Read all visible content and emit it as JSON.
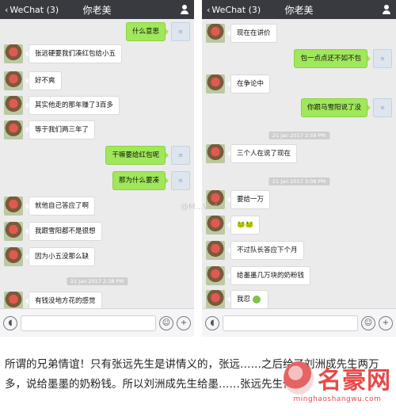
{
  "left_phone": {
    "back_label": "WeChat (3)",
    "title": "你老美",
    "messages": [
      {
        "side": "right",
        "text": "什么意思"
      },
      {
        "side": "left",
        "text": "张远硬要我们凑红包给小五"
      },
      {
        "side": "left",
        "text": "好不爽"
      },
      {
        "side": "left",
        "text": "其实他走的那年赚了3百多"
      },
      {
        "side": "left",
        "text": "等于我们两三年了"
      },
      {
        "side": "right",
        "text": "干嘛要给红包呢"
      },
      {
        "side": "right",
        "text": "那为什么要凑"
      },
      {
        "side": "left",
        "text": "就他自己答应了啊"
      },
      {
        "side": "left",
        "text": "我跟雪阳都不是很想"
      },
      {
        "side": "left",
        "text": "因为小五没那么缺"
      },
      {
        "side": "stamp",
        "text": "21 Jan 2017 2:38 PM"
      },
      {
        "side": "left",
        "text": "有钱没地方花的感觉"
      }
    ]
  },
  "right_phone": {
    "back_label": "WeChat (3)",
    "title": "你老美",
    "messages": [
      {
        "side": "left",
        "text": "现在在讲价"
      },
      {
        "side": "right",
        "text": "包一点点还不如不包"
      },
      {
        "side": "left",
        "text": "在争论中"
      },
      {
        "side": "right",
        "text": "你跟马雪阳说了没"
      },
      {
        "side": "stamp",
        "text": "21 Jan 2017 2:59 PM"
      },
      {
        "side": "left",
        "text": "三个人在说了现在"
      },
      {
        "side": "stamp",
        "text": "21 Jan 2017 3:08 PM"
      },
      {
        "side": "left",
        "text": "要给一万"
      },
      {
        "side": "left",
        "text": "🐸🐸"
      },
      {
        "side": "left",
        "text": "不过队长答应下个月"
      },
      {
        "side": "left",
        "text": "给墨墨几万块的奶粉钱"
      },
      {
        "side": "left",
        "text": "我忍"
      }
    ]
  },
  "watermark": "@M...Vivi",
  "caption": "所谓的兄弟情谊！只有张远先生是讲情义的，张远……之后给了刘洲成先生两万多，说给墨墨的奶粉钱。所以刘洲成先生给墨……张远先生付的。",
  "logo": {
    "name": "名豪网",
    "url": "minghaoshangwu.com"
  }
}
